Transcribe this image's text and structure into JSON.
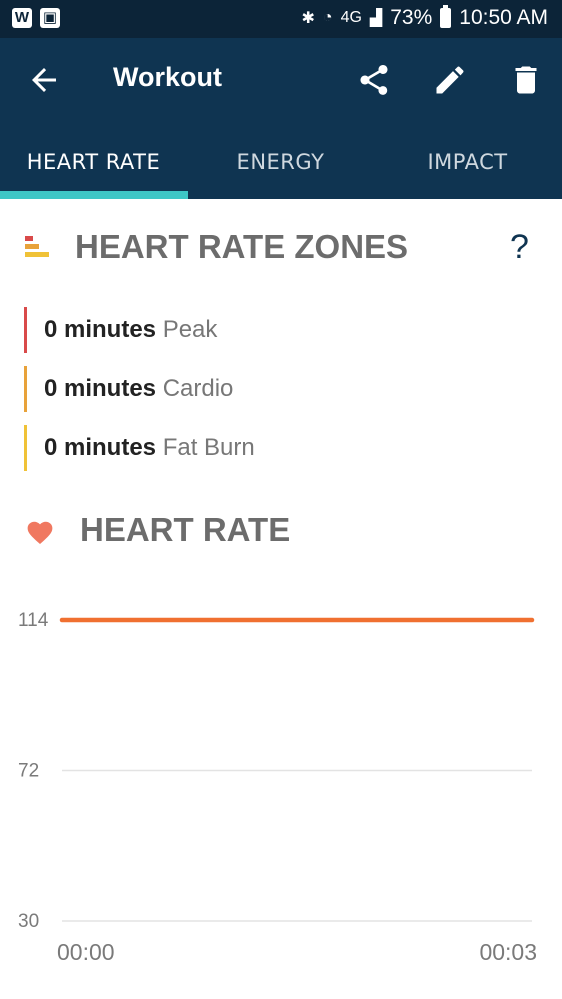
{
  "status_bar": {
    "left_badges": [
      "W",
      "▣"
    ],
    "signal_text": "4G",
    "battery": "73%",
    "time": "10:50 AM"
  },
  "app_bar": {
    "title": "Workout",
    "icons": [
      "back-arrow",
      "share",
      "edit-pencil",
      "trash"
    ]
  },
  "tabs": [
    {
      "label": "HEART RATE",
      "active": true
    },
    {
      "label": "ENERGY",
      "active": false
    },
    {
      "label": "IMPACT",
      "active": false
    }
  ],
  "zones": {
    "title": "HEART RATE ZONES",
    "help": "?",
    "items": [
      {
        "value": "0 minutes",
        "label": "Peak",
        "color": "#d94a4a"
      },
      {
        "value": "0 minutes",
        "label": "Cardio",
        "color": "#e8a23a"
      },
      {
        "value": "0 minutes",
        "label": "Fat Burn",
        "color": "#f0c237"
      }
    ]
  },
  "heart_rate": {
    "title": "HEART RATE"
  },
  "colors": {
    "header": "#0f3451",
    "statusbar": "#0c2438",
    "tab_indicator": "#3ec6c6",
    "heart": "#f07860",
    "line": "#f07030"
  },
  "chart_data": {
    "type": "line",
    "x": [
      "00:00",
      "00:03"
    ],
    "series": [
      {
        "values": [
          114,
          114
        ]
      }
    ],
    "yticks": [
      114,
      72,
      30
    ],
    "xticks": [
      "00:00",
      "00:03"
    ],
    "ylim": [
      30,
      114
    ],
    "grid": true
  }
}
